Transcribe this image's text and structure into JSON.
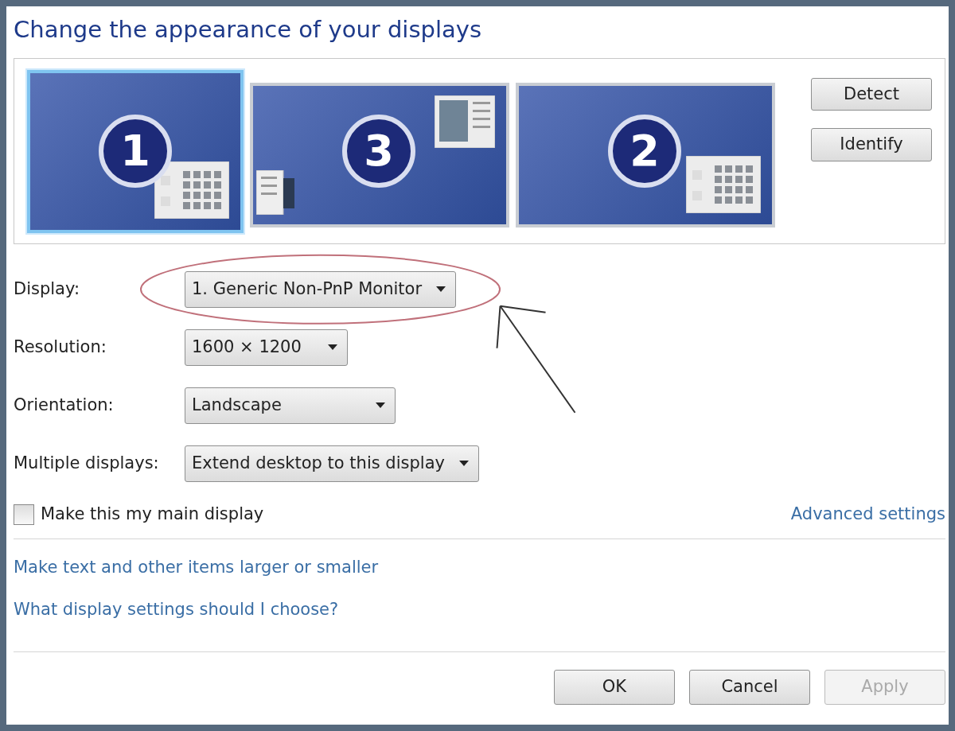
{
  "title": "Change the appearance of your displays",
  "monitors": [
    {
      "number": "1",
      "selected": true,
      "kind": "grid"
    },
    {
      "number": "3",
      "selected": false,
      "kind": "windows"
    },
    {
      "number": "2",
      "selected": false,
      "kind": "grid"
    }
  ],
  "side_buttons": [
    "Detect",
    "Identify"
  ],
  "settings": [
    {
      "label": "Display:",
      "value": "1. Generic Non-PnP Monitor",
      "circled": true
    },
    {
      "label": "Resolution:",
      "value": "1600 × 1200",
      "circled": false
    },
    {
      "label": "Orientation:",
      "value": "Landscape",
      "circled": false
    },
    {
      "label": "Multiple displays:",
      "value": "Extend desktop to this display",
      "circled": false
    }
  ],
  "main_display": {
    "label": "Make this my main display",
    "checked": false
  },
  "advanced_link": "Advanced settings",
  "links": [
    "Make text and other items larger or smaller",
    "What display settings should I choose?"
  ],
  "buttons": [
    {
      "label": "OK",
      "disabled": false
    },
    {
      "label": "Cancel",
      "disabled": false
    },
    {
      "label": "Apply",
      "disabled": true
    }
  ]
}
